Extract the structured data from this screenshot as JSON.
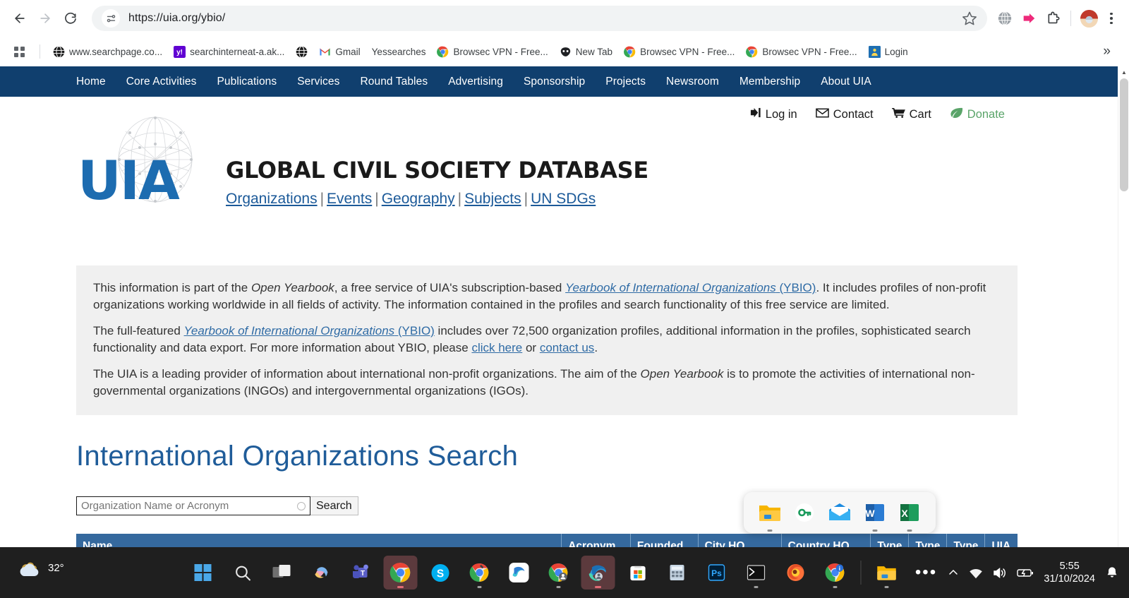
{
  "browser": {
    "url": "https://uia.org/ybio/",
    "back_label": "Back",
    "forward_label": "Forward",
    "reload_label": "Reload",
    "site_info_label": "View site information",
    "bookmark_label": "Bookmark this tab",
    "apps_label": "All bookmarks",
    "overflow_label": "»",
    "menu_label": "Customize and control Google Chrome",
    "bookmarks": [
      {
        "label": "www.searchpage.co...",
        "icon": "globe-icon"
      },
      {
        "label": "searchinterneat-a.ak...",
        "icon": "yahoo-icon"
      },
      {
        "label": "Gmail",
        "icon": "gmail-icon",
        "leading_icon": "globe-icon"
      },
      {
        "label": "Yessearches",
        "icon": "none"
      },
      {
        "label": "Browsec VPN - Free...",
        "icon": "chrome-icon"
      },
      {
        "label": "New Tab",
        "icon": "mask-icon"
      },
      {
        "label": "Browsec VPN - Free...",
        "icon": "chrome-icon"
      },
      {
        "label": "Browsec VPN - Free...",
        "icon": "chrome-icon"
      },
      {
        "label": "Login",
        "icon": "login-icon"
      }
    ]
  },
  "site": {
    "nav": [
      "Home",
      "Core Activities",
      "Publications",
      "Services",
      "Round Tables",
      "Advertising",
      "Sponsorship",
      "Projects",
      "Newsroom",
      "Membership",
      "About UIA"
    ],
    "utility": [
      {
        "label": "Log in",
        "icon": "login-arrow-icon"
      },
      {
        "label": "Contact",
        "icon": "envelope-icon"
      },
      {
        "label": "Cart",
        "icon": "cart-icon"
      },
      {
        "label": "Donate",
        "icon": "leaf-icon"
      }
    ],
    "logo_text": "UIA",
    "masthead_title": "GLOBAL CIVIL SOCIETY DATABASE",
    "masthead_links": [
      "Organizations",
      "Events",
      "Geography",
      "Subjects",
      "UN SDGs"
    ],
    "colors": {
      "navbar": "#103f6e",
      "logo_blue": "#1d6cb0",
      "heading_blue": "#1f5c99",
      "table_header": "#35699e",
      "donate_green": "#5aa469"
    }
  },
  "infobox": {
    "p1_a": "This information is part of the ",
    "p1_em1": "Open Yearbook",
    "p1_b": ", a free service of UIA's subscription-based ",
    "p1_link": "Yearbook of International Organizations",
    "p1_link_suffix": " (YBIO)",
    "p1_c": ". It includes profiles of non-profit organizations working worldwide in all fields of activity. The information contained in the profiles and search functionality of this free service are limited.",
    "p2_a": "The full-featured ",
    "p2_link": "Yearbook of International Organizations",
    "p2_link_suffix": " (YBIO)",
    "p2_b": " includes over 72,500 organization profiles, additional information in the profiles, sophisticated search functionality and data export. For more information about YBIO, please ",
    "p2_link2": "click here",
    "p2_c": " or ",
    "p2_link3": "contact us",
    "p2_d": ".",
    "p3_a": "The UIA is a leading provider of information about international non-profit organizations. The aim of the ",
    "p3_em": "Open Yearbook",
    "p3_b": " is to promote the activities of international non-governmental organizations (INGOs) and intergovernmental organizations (IGOs)."
  },
  "search": {
    "heading": "International Organizations Search",
    "placeholder": "Organization Name or Acronym",
    "value": "",
    "button_label": "Search",
    "spinner_label": "loading-spinner"
  },
  "table": {
    "columns": [
      "Name",
      "Acronym",
      "Founded",
      "City HQ",
      "Country HQ",
      "Type I",
      "Type II",
      "Type III",
      "UIA Org ID"
    ]
  },
  "float_bar": {
    "items": [
      {
        "name": "file-explorer-icon",
        "label": "File Explorer"
      },
      {
        "name": "password-key-icon",
        "label": "Passwords"
      },
      {
        "name": "mail-icon",
        "label": "Mail"
      },
      {
        "name": "word-icon",
        "label": "Word"
      },
      {
        "name": "excel-icon",
        "label": "Excel"
      }
    ]
  },
  "taskbar": {
    "weather_temp": "32°",
    "weather_icon": "cloud-icon",
    "apps": [
      {
        "name": "start-button",
        "label": "Start"
      },
      {
        "name": "search-taskbar-button",
        "label": "Search"
      },
      {
        "name": "task-view-button",
        "label": "Task View"
      },
      {
        "name": "copilot-button",
        "label": "Copilot"
      },
      {
        "name": "teams-button",
        "label": "Microsoft Teams"
      },
      {
        "name": "chrome-button",
        "label": "Google Chrome"
      },
      {
        "name": "skype-button",
        "label": "Skype"
      },
      {
        "name": "chrome-tools-button",
        "label": "Chrome"
      },
      {
        "name": "edge-beta-button",
        "label": "Edge"
      },
      {
        "name": "chrome-profile-button",
        "label": "Chrome"
      },
      {
        "name": "edge-button",
        "label": "Microsoft Edge"
      },
      {
        "name": "store-button",
        "label": "Microsoft Store"
      },
      {
        "name": "calculator-button",
        "label": "Calculator"
      },
      {
        "name": "photoshop-button",
        "label": "Photoshop"
      },
      {
        "name": "terminal-button",
        "label": "Terminal"
      },
      {
        "name": "firefox-button",
        "label": "Firefox"
      },
      {
        "name": "chrome-info-button",
        "label": "Chrome"
      },
      {
        "name": "file-explorer-button",
        "label": "File Explorer"
      },
      {
        "name": "more-button",
        "label": "•••"
      }
    ],
    "tray": {
      "chevron": "show-hidden-icons",
      "wifi": "wifi-icon",
      "volume": "volume-icon",
      "battery": "battery-charging-icon",
      "time": "5:55",
      "date": "31/10/2024",
      "notifications": "notifications-icon"
    }
  }
}
